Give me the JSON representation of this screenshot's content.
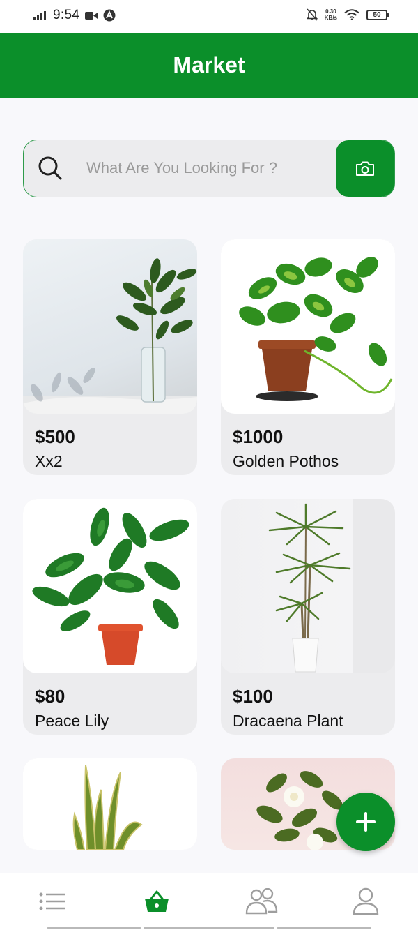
{
  "status_bar": {
    "time": "9:54",
    "net_speed_value": "0.30",
    "net_speed_unit": "KB/s",
    "battery": "50",
    "icons": [
      "signal-icon",
      "video-icon",
      "app-notification-icon",
      "mute-notifications-icon",
      "wifi-icon",
      "battery-icon"
    ]
  },
  "app_bar": {
    "title": "Market"
  },
  "search": {
    "placeholder": "What Are You Looking For ?",
    "icon": "search-icon",
    "camera_icon": "camera-icon"
  },
  "products": [
    {
      "price": "$500",
      "name": "Xx2"
    },
    {
      "price": "$1000",
      "name": "Golden Pothos"
    },
    {
      "price": "$80",
      "name": "Peace Lily"
    },
    {
      "price": "$100",
      "name": "Dracaena Plant"
    }
  ],
  "fab": {
    "icon": "plus-icon"
  },
  "bottom_nav": {
    "items": [
      {
        "icon": "list-icon"
      },
      {
        "icon": "basket-icon",
        "active": true
      },
      {
        "icon": "users-icon"
      },
      {
        "icon": "profile-icon"
      }
    ]
  },
  "colors": {
    "brand": "#0b8f2a",
    "background": "#f8f8fb",
    "card": "#ececee",
    "inactive_icon": "#9e9e9e"
  }
}
